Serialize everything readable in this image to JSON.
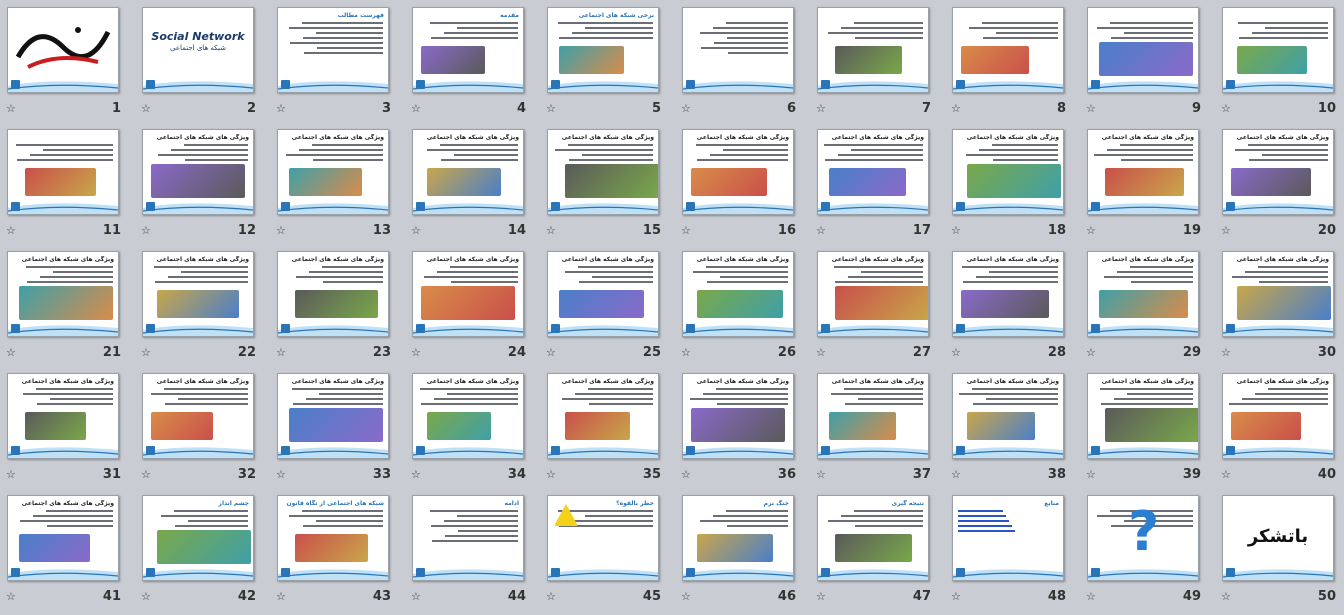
{
  "view": "slide-sorter",
  "accent_color": "#2a74b8",
  "star_glyph": "☆",
  "slides": [
    {
      "number": "1",
      "title": "",
      "kind": "calligraphy"
    },
    {
      "number": "2",
      "title": "Social Network",
      "subtitle": "شبکه های اجتماعی",
      "kind": "cover"
    },
    {
      "number": "3",
      "title": "فهرست مطالب",
      "kind": "list"
    },
    {
      "number": "4",
      "title": "مقدمه",
      "kind": "image-text"
    },
    {
      "number": "5",
      "title": "برخی شبکه های اجتماعی",
      "kind": "logos"
    },
    {
      "number": "6",
      "title": "",
      "kind": "text"
    },
    {
      "number": "7",
      "title": "",
      "kind": "table"
    },
    {
      "number": "8",
      "title": "",
      "kind": "profile"
    },
    {
      "number": "9",
      "title": "",
      "kind": "profile"
    },
    {
      "number": "10",
      "title": "",
      "kind": "profile"
    },
    {
      "number": "11",
      "title": "",
      "kind": "profile"
    },
    {
      "number": "12",
      "title": "ویژگی های شبکه های اجتماعی",
      "kind": "text-image"
    },
    {
      "number": "13",
      "title": "ویژگی های شبکه های اجتماعی",
      "kind": "text-image"
    },
    {
      "number": "14",
      "title": "ویژگی های شبکه های اجتماعی",
      "kind": "text-image"
    },
    {
      "number": "15",
      "title": "ویژگی های شبکه های اجتماعی",
      "kind": "text-image"
    },
    {
      "number": "16",
      "title": "ویژگی های شبکه های اجتماعی",
      "kind": "text-image"
    },
    {
      "number": "17",
      "title": "ویژگی های شبکه های اجتماعی",
      "kind": "text-image"
    },
    {
      "number": "18",
      "title": "ویژگی های شبکه های اجتماعی",
      "kind": "text-image"
    },
    {
      "number": "19",
      "title": "ویژگی های شبکه های اجتماعی",
      "kind": "text-image"
    },
    {
      "number": "20",
      "title": "ویژگی های شبکه های اجتماعی",
      "kind": "text-image"
    },
    {
      "number": "21",
      "title": "ویژگی های شبکه های اجتماعی",
      "kind": "text-image"
    },
    {
      "number": "22",
      "title": "ویژگی های شبکه های اجتماعی",
      "kind": "text-image"
    },
    {
      "number": "23",
      "title": "ویژگی های شبکه های اجتماعی",
      "kind": "text-image"
    },
    {
      "number": "24",
      "title": "ویژگی های شبکه های اجتماعی",
      "kind": "text-image"
    },
    {
      "number": "25",
      "title": "ویژگی های شبکه های اجتماعی",
      "kind": "text-image"
    },
    {
      "number": "26",
      "title": "ویژگی های شبکه های اجتماعی",
      "kind": "text-image"
    },
    {
      "number": "27",
      "title": "ویژگی های شبکه های اجتماعی",
      "kind": "text-image"
    },
    {
      "number": "28",
      "title": "ویژگی های شبکه های اجتماعی",
      "kind": "text-image"
    },
    {
      "number": "29",
      "title": "ویژگی های شبکه های اجتماعی",
      "kind": "text-image"
    },
    {
      "number": "30",
      "title": "ویژگی های شبکه های اجتماعی",
      "kind": "text-image"
    },
    {
      "number": "31",
      "title": "ویژگی های شبکه های اجتماعی",
      "kind": "text-image"
    },
    {
      "number": "32",
      "title": "ویژگی های شبکه های اجتماعی",
      "kind": "text-image"
    },
    {
      "number": "33",
      "title": "ویژگی های شبکه های اجتماعی",
      "kind": "text-image"
    },
    {
      "number": "34",
      "title": "ویژگی های شبکه های اجتماعی",
      "kind": "text-image"
    },
    {
      "number": "35",
      "title": "ویژگی های شبکه های اجتماعی",
      "kind": "text-image"
    },
    {
      "number": "36",
      "title": "ویژگی های شبکه های اجتماعی",
      "kind": "text-image"
    },
    {
      "number": "37",
      "title": "ویژگی های شبکه های اجتماعی",
      "kind": "text-image"
    },
    {
      "number": "38",
      "title": "ویژگی های شبکه های اجتماعی",
      "kind": "text-image"
    },
    {
      "number": "39",
      "title": "ویژگی های شبکه های اجتماعی",
      "kind": "text-image"
    },
    {
      "number": "40",
      "title": "ویژگی های شبکه های اجتماعی",
      "kind": "text-image"
    },
    {
      "number": "41",
      "title": "ویژگی های شبکه های اجتماعی",
      "kind": "text-image"
    },
    {
      "number": "42",
      "title": "چشم انداز",
      "kind": "text-image"
    },
    {
      "number": "43",
      "title": "شبکه های اجتماعی از نگاه قانون",
      "kind": "text-image"
    },
    {
      "number": "44",
      "title": "ادامه",
      "kind": "text"
    },
    {
      "number": "45",
      "title": "خطر بالقوه؟",
      "kind": "warning"
    },
    {
      "number": "46",
      "title": "جنگ نرم",
      "kind": "text-image"
    },
    {
      "number": "47",
      "title": "نتیجه گیری",
      "kind": "text-image"
    },
    {
      "number": "48",
      "title": "منابع",
      "kind": "links"
    },
    {
      "number": "49",
      "title": "",
      "kind": "question"
    },
    {
      "number": "50",
      "title": "باتشکر",
      "kind": "thanks"
    }
  ]
}
